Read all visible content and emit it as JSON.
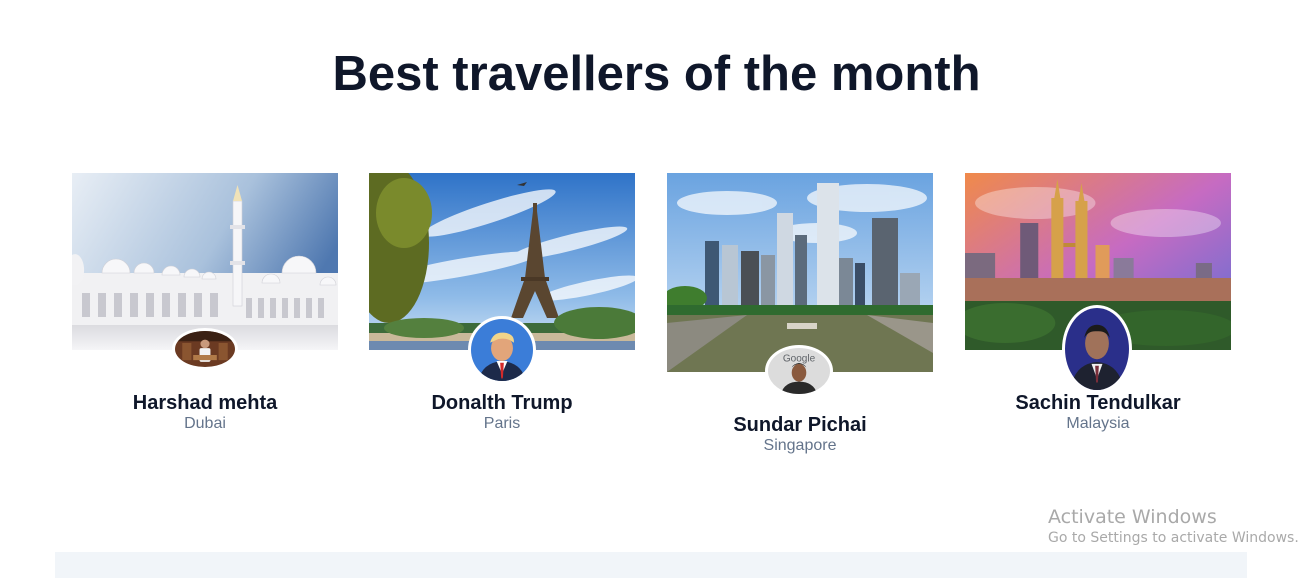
{
  "section_title": "Best travellers of the month",
  "travellers": [
    {
      "name": "Harshad mehta",
      "location": "Dubai"
    },
    {
      "name": "Donalth Trump",
      "location": "Paris"
    },
    {
      "name": "Sundar Pichai",
      "location": "Singapore"
    },
    {
      "name": "Sachin Tendulkar",
      "location": "Malaysia"
    }
  ],
  "avatar_text": {
    "google_sign": "Google"
  },
  "watermark": {
    "title": "Activate Windows",
    "subtitle": "Go to Settings to activate Windows."
  }
}
